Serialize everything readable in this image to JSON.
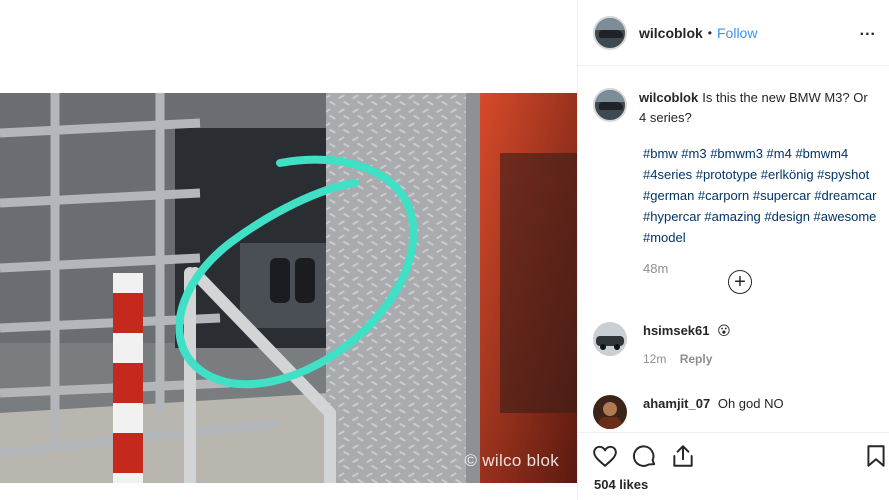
{
  "post": {
    "username": "wilcoblok",
    "follow_label": "Follow",
    "dot": "•",
    "more_label": "...",
    "caption": "Is this the new BMW M3? Or 4 series?",
    "hashtags": "#bmw #m3 #bmwm3 #m4 #bmwm4 #4series #prototype #erlkönig #spyshot #german #carporn #supercar #dreamcar #hypercar #amazing #design #awesome #model",
    "time": "48m",
    "load_more": "+",
    "likes": "504 likes",
    "watermark": "© wilco blok"
  },
  "comments": [
    {
      "username": "hsimsek61",
      "text": "😮",
      "time": "12m",
      "reply_label": "Reply"
    },
    {
      "username": "ahamjit_07",
      "text": "Oh god NO"
    }
  ],
  "icons": {
    "like": "heart-icon",
    "comment": "comment-icon",
    "share": "share-icon",
    "save": "bookmark-icon",
    "more": "more-options-icon",
    "load_more": "plus-circle-icon"
  },
  "colors": {
    "link": "#3897f0",
    "hashtag": "#003569",
    "muted": "#8e8e8e",
    "circle_annotation": "#3fe0c5"
  }
}
